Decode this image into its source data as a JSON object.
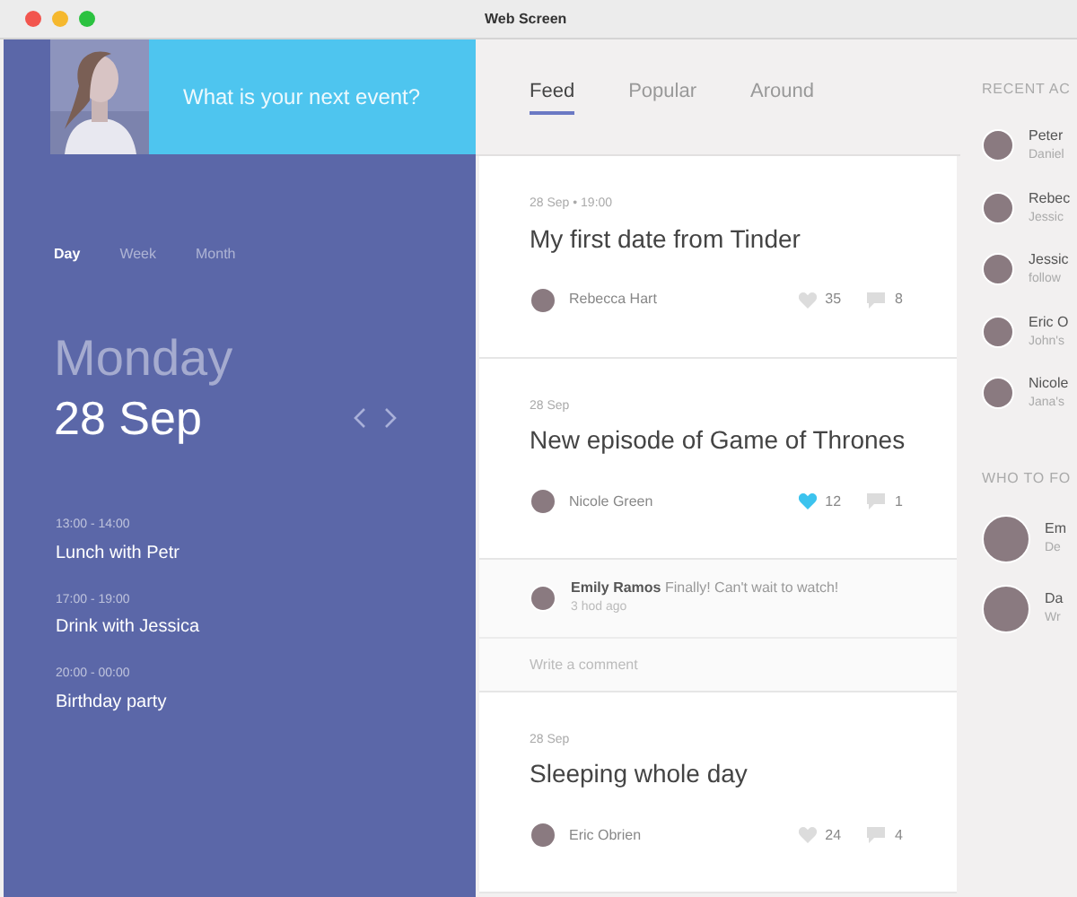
{
  "window": {
    "title": "Web Screen"
  },
  "header": {
    "prompt": "What is your next event?"
  },
  "view_tabs": [
    {
      "label": "Day",
      "selected": true
    },
    {
      "label": "Week",
      "selected": false
    },
    {
      "label": "Month",
      "selected": false
    }
  ],
  "date": {
    "weekday": "Monday",
    "day": "28 Sep"
  },
  "events": [
    {
      "time": "13:00 - 14:00",
      "title": "Lunch with Petr"
    },
    {
      "time": "17:00 - 19:00",
      "title": "Drink with Jessica"
    },
    {
      "time": "20:00 - 00:00",
      "title": "Birthday party"
    }
  ],
  "feed_tabs": [
    {
      "label": "Feed",
      "selected": true
    },
    {
      "label": "Popular",
      "selected": false
    },
    {
      "label": "Around",
      "selected": false
    }
  ],
  "posts": [
    {
      "meta": "28 Sep • 19:00",
      "title": "My first date from Tinder",
      "author": "Rebecca Hart",
      "likes": "35",
      "liked": false,
      "comments": "8"
    },
    {
      "meta": "28 Sep",
      "title": "New episode of Game of Thrones",
      "author": "Nicole Green",
      "likes": "12",
      "liked": true,
      "comments": "1",
      "thread": [
        {
          "author": "Emily Ramos",
          "text": "Finally! Can't wait to watch!",
          "time": "3 hod ago"
        }
      ],
      "comment_placeholder": "Write a comment"
    },
    {
      "meta": "28 Sep",
      "title": "Sleeping whole day",
      "author": "Eric Obrien",
      "likes": "24",
      "liked": false,
      "comments": "4"
    }
  ],
  "recent_activity": {
    "heading": "RECENT AC",
    "items": [
      {
        "name": "Peter",
        "detail": "Daniel"
      },
      {
        "name": "Rebec",
        "detail": "Jessic"
      },
      {
        "name": "Jessic",
        "detail": "follow"
      },
      {
        "name": "Eric O",
        "detail": "John's"
      },
      {
        "name": "Nicole",
        "detail": "Jana's"
      }
    ]
  },
  "who_to_follow": {
    "heading": "WHO TO FO",
    "items": [
      {
        "name": "Em",
        "detail": "De"
      },
      {
        "name": "Da",
        "detail": "Wr"
      }
    ]
  }
}
